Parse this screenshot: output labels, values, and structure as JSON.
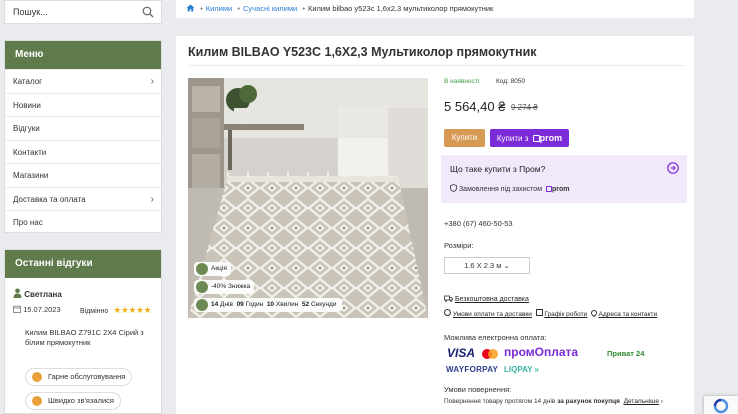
{
  "search": {
    "placeholder": "Пошук..."
  },
  "menu": {
    "title": "Меню",
    "items": [
      {
        "label": "Каталог",
        "has_submenu": true
      },
      {
        "label": "Новини",
        "has_submenu": false
      },
      {
        "label": "Відгуки",
        "has_submenu": false
      },
      {
        "label": "Контакти",
        "has_submenu": false
      },
      {
        "label": "Магазини",
        "has_submenu": false
      },
      {
        "label": "Доставка та оплата",
        "has_submenu": true
      },
      {
        "label": "Про нас",
        "has_submenu": false
      }
    ]
  },
  "reviews": {
    "title": "Останні відгуки",
    "author": "Светлана",
    "date": "15.07.2023",
    "rating_label": "Відмінно",
    "stars": 5,
    "product": "Килим BILBAO Z791C 2X4 Сірий з білим прямокутник",
    "tags": [
      "Гарне обслуговування",
      "Швидко зв'язалися"
    ]
  },
  "breadcrumb": {
    "items": [
      "Килими",
      "Сучасні килими"
    ],
    "current": "Килим bilbao y523c 1,6x2,3 мультиколор прямокутник"
  },
  "product": {
    "title": "Килим BILBAO Y523C 1,6X2,3 Мультиколор прямокутник",
    "availability": "В наявності",
    "code_label": "Код:",
    "code": "8050",
    "price": "5 564,40 ₴",
    "old_price": "9 274 ₴",
    "buy_label": "Купити",
    "buy_prom_label": "Купити з",
    "prom_brand": "prom",
    "prom_question": "Що таке купити з Пром?",
    "prom_protection": "Замовлення під захистом",
    "phone": "+380 (67) 460-50-53",
    "sizes_label": "Розміри:",
    "size_selected": "1.6 X 2.3 м",
    "delivery": "Безкоштовна доставка",
    "links": [
      "Умови оплати та доставки",
      "Графік роботи",
      "Адреса та контакти"
    ],
    "payment_label": "Можлива електронна оплата:",
    "payments": [
      "VISA",
      "промОплата",
      "Приват 24",
      "WAYFORPAY",
      "LIQPAY"
    ],
    "returns_label": "Умови повернення:",
    "returns_text": "Повернення товару протягом 14 днів",
    "returns_bold": "за рахунок покупця",
    "details": "Детальніше"
  },
  "promo": {
    "action_label": "Акція",
    "discount_label": "-40% Знижка",
    "timer": {
      "days": "14",
      "days_label": "Днів",
      "hours": "09",
      "hours_label": "Годин",
      "minutes": "10",
      "minutes_label": "Хвилин",
      "seconds": "52",
      "seconds_label": "Секунди"
    }
  },
  "colors": {
    "green": "#5f7a4b",
    "buy": "#d79a55",
    "prom": "#7b2bd8",
    "link": "#2a7fd4",
    "availability": "#3f9d3f"
  }
}
